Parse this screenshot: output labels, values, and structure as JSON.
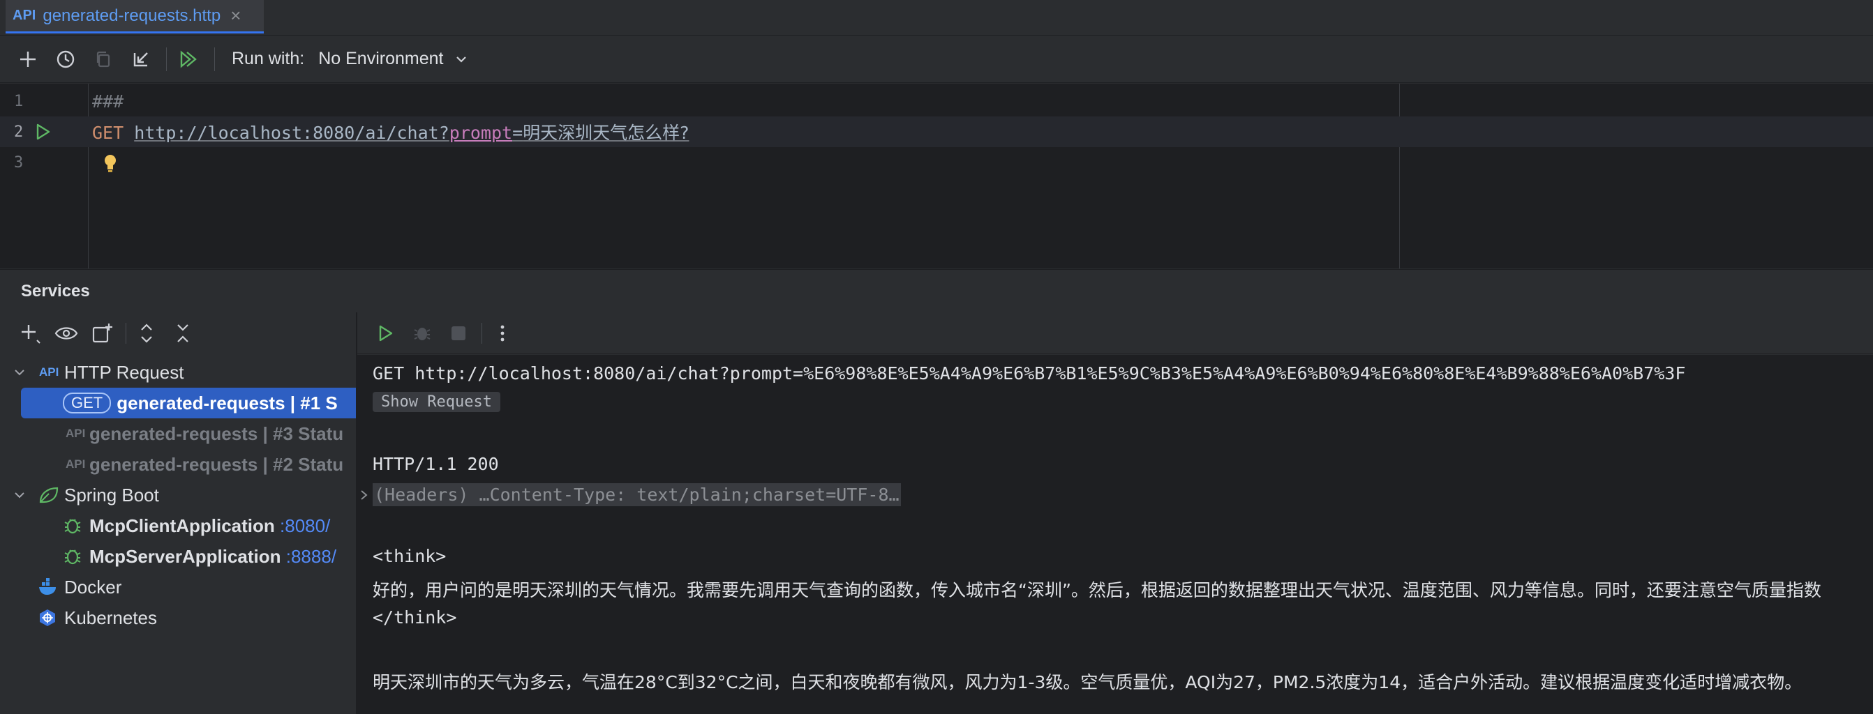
{
  "tab": {
    "icon": "API",
    "label": "generated-requests.http",
    "close": "×"
  },
  "toolbar": {
    "icons": [
      "plus-icon",
      "history-icon",
      "copy-icon",
      "import-icon",
      "run-all-icon"
    ],
    "run_with_label": "Run with:",
    "environment": "No Environment"
  },
  "editor": {
    "lines": [
      {
        "num": "1",
        "text": "###"
      },
      {
        "num": "2",
        "method": "GET",
        "url": "http://localhost:8080/ai/chat?",
        "param": "prompt",
        "eq": "=",
        "value": "明天深圳天气怎么样?"
      },
      {
        "num": "3",
        "text": ""
      }
    ]
  },
  "services": {
    "title": "Services",
    "tree": {
      "http_request": "HTTP Request",
      "selected_method": "GET",
      "selected_label": "generated-requests  |  #1 S",
      "item3": "generated-requests | #3 Statu",
      "item2": "generated-requests | #2 Statu",
      "spring_boot": "Spring Boot",
      "client_app": "McpClientApplication",
      "client_port": ":8080/",
      "server_app": "McpServerApplication",
      "server_port": ":8888/",
      "docker": "Docker",
      "kubernetes": "Kubernetes"
    }
  },
  "output": {
    "request_line": "GET http://localhost:8080/ai/chat?prompt=%E6%98%8E%E5%A4%A9%E6%B7%B1%E5%9C%B3%E5%A4%A9%E6%B0%94%E6%80%8E%E4%B9%88%E6%A0%B7%3F",
    "show_request": "Show Request",
    "status": "HTTP/1.1 200",
    "headers": "(Headers) …Content-Type: text/plain;charset=UTF-8…",
    "think_open": "<think>",
    "think_text": "好的，用户问的是明天深圳的天气情况。我需要先调用天气查询的函数，传入城市名“深圳”。然后，根据返回的数据整理出天气状况、温度范围、风力等信息。同时，还要注意空气质量指数",
    "think_close": "</think>",
    "answer": "明天深圳市的天气为多云，气温在28°C到32°C之间，白天和夜晚都有微风，风力为1-3级。空气质量优，AQI为27，PM2.5浓度为14，适合户外活动。建议根据温度变化适时增减衣物。"
  }
}
